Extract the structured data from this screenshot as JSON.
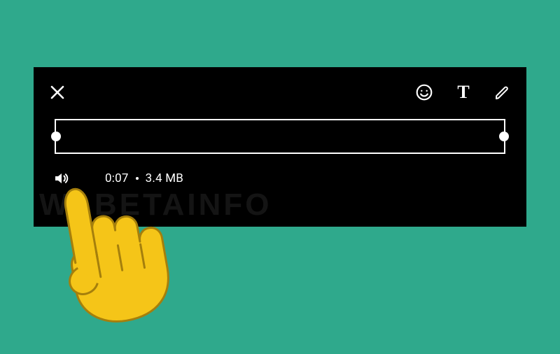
{
  "toolbar": {
    "close": "Close",
    "emoji": "Emoji",
    "text_tool": "T",
    "draw": "Draw"
  },
  "info": {
    "duration": "0:07",
    "size": "3.4 MB"
  },
  "watermark": "WABETAINFO",
  "colors": {
    "background": "#2fa98c",
    "panel": "#000000",
    "hand": "#f5c518"
  }
}
